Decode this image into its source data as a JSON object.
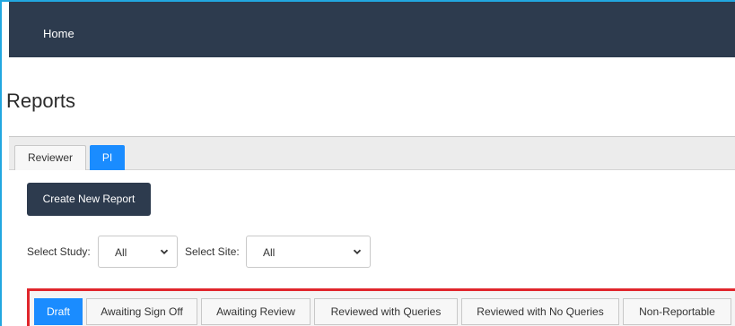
{
  "navbar": {
    "home_label": "Home"
  },
  "page": {
    "title": "Reports"
  },
  "top_tabs": [
    {
      "label": "Reviewer",
      "active": false
    },
    {
      "label": "PI",
      "active": true
    }
  ],
  "actions": {
    "create_label": "Create New Report"
  },
  "filters": {
    "study_label": "Select Study:",
    "study_value": "All",
    "site_label": "Select Site:",
    "site_value": "All"
  },
  "status_tabs": [
    {
      "label": "Draft",
      "active": true
    },
    {
      "label": "Awaiting Sign Off",
      "active": false
    },
    {
      "label": "Awaiting Review",
      "active": false
    },
    {
      "label": "Reviewed with Queries",
      "active": false
    },
    {
      "label": "Reviewed with No Queries",
      "active": false
    },
    {
      "label": "Non-Reportable",
      "active": false
    }
  ],
  "colors": {
    "navbar": "#2d3b4e",
    "active_tab": "#1a8cff",
    "highlight_border": "#e0262c",
    "frame_accent": "#22a7e0"
  },
  "icons": {
    "select_arrow": "chevron-down-icon"
  }
}
